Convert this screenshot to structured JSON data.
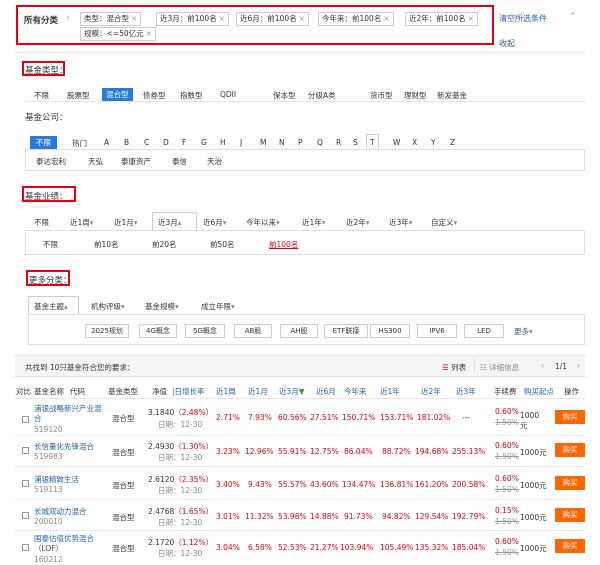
{
  "filter_bar": {
    "label": "所有分类",
    "tags": [
      "类型：混合型",
      "近3月：前100名",
      "近6月：前100名",
      "今年来：前100名",
      "近2年：前100名",
      "规模：<=50亿元"
    ],
    "clear_label": "清空所选条件",
    "collapse_label": "收起"
  },
  "fund_type": {
    "title": "基金类型：",
    "options": [
      "不限",
      "股票型",
      "混合型",
      "债券型",
      "指数型",
      "QDII",
      "保本型",
      "分级A类",
      "货币型",
      "理财型",
      "新发基金"
    ]
  },
  "company": {
    "title": "基金公司：",
    "letters": [
      "不限",
      "热门",
      "A",
      "B",
      "C",
      "D",
      "F",
      "G",
      "H",
      "J",
      "M",
      "N",
      "P",
      "Q",
      "R",
      "S",
      "T",
      "W",
      "X",
      "Y",
      "Z"
    ],
    "names": [
      "泰达宏利",
      "天弘",
      "泰康资产",
      "泰信",
      "天治"
    ]
  },
  "performance": {
    "title": "基金业绩：",
    "periods": [
      "不限",
      "近1周",
      "近1月",
      "近3月",
      "近6月",
      "今年以来",
      "近1年",
      "近2年",
      "近3年",
      "自定义"
    ],
    "ranks": [
      "不限",
      "前10名",
      "前20名",
      "前50名",
      "前100名"
    ]
  },
  "more": {
    "title": "更多分类：",
    "tabs": [
      "基金主题",
      "机构评级",
      "基金规模",
      "成立年限"
    ],
    "themes": [
      "2025规划",
      "4G概念",
      "5G概念",
      "AB股",
      "AH股",
      "ETF联接",
      "HS300",
      "IPV6",
      "LED"
    ],
    "more_label": "更多"
  },
  "result": {
    "text": "共找到 10只基金符合您的要求：",
    "view_list": "列表",
    "view_detail": "详细信息",
    "page": "1/1"
  },
  "table": {
    "headers": [
      "对比",
      "基金名称",
      "代码",
      "基金类型",
      "净值",
      "日增长率",
      "近1周",
      "近1月",
      "近3月",
      "近6月",
      "今年来",
      "近1年",
      "近2年",
      "近3年",
      "手续费",
      "购买起点",
      "操作"
    ],
    "rows": [
      {
        "name": "浦银战略新兴产业混合",
        "code": "519120",
        "type": "混合型",
        "nav": "3.1840",
        "growth": "（2.48%）",
        "date": "日期：12-30",
        "w1": "2.71%",
        "m1": "7.93%",
        "m3": "60.56%",
        "m6": "27.51%",
        "ytd": "150.71%",
        "y1": "153.71%",
        "y2": "181.02%",
        "y3": "---",
        "fee": "0.60%",
        "fee_old": "1.50%",
        "start": "1000元",
        "buy": "购买"
      },
      {
        "name": "长信量化先锋混合",
        "code": "519983",
        "type": "混合型",
        "nav": "2.4930",
        "growth": "（1.30%）",
        "date": "日期：12-30",
        "w1": "3.23%",
        "m1": "12.96%",
        "m3": "55.91%",
        "m6": "12.75%",
        "ytd": "86.04%",
        "y1": "88.72%",
        "y2": "194.68%",
        "y3": "255.13%",
        "fee": "0.60%",
        "fee_old": "1.50%",
        "start": "1000元",
        "buy": "购买"
      },
      {
        "name": "浦银精致生活",
        "code": "519113",
        "type": "混合型",
        "nav": "2.6120",
        "growth": "（2.35%）",
        "date": "日期：12-30",
        "w1": "3.40%",
        "m1": "9.43%",
        "m3": "55.57%",
        "m6": "43.60%",
        "ytd": "134.47%",
        "y1": "136.81%",
        "y2": "161.20%",
        "y3": "200.58%",
        "fee": "0.60%",
        "fee_old": "1.50%",
        "start": "1000元",
        "buy": "购买"
      },
      {
        "name": "长城双动力混合",
        "code": "200010",
        "type": "混合型",
        "nav": "2.4768",
        "growth": "（1.65%）",
        "date": "日期：12-30",
        "w1": "3.01%",
        "m1": "11.32%",
        "m3": "53.98%",
        "m6": "14.88%",
        "ytd": "91.73%",
        "y1": "94.82%",
        "y2": "129.54%",
        "y3": "192.79%",
        "fee": "0.15%",
        "fee_old": "1.50%",
        "start": "1000元",
        "buy": "购买"
      },
      {
        "name": "国泰估值优势混合（LOF）",
        "code": "160212",
        "type": "混合型",
        "nav": "2.1720",
        "growth": "（1.12%）",
        "date": "日期：12-30",
        "w1": "3.04%",
        "m1": "6.58%",
        "m3": "52.53%",
        "m6": "21.27%",
        "ytd": "103.94%",
        "y1": "105.49%",
        "y2": "135.32%",
        "y3": "185.04%",
        "fee": "0.60%",
        "fee_old": "1.50%",
        "start": "1000元",
        "buy": "购买"
      }
    ]
  },
  "colors": {
    "accent": "#2a7ad6",
    "red": "#e60012",
    "buy": "#ff6600",
    "link": "#2a5caa"
  }
}
